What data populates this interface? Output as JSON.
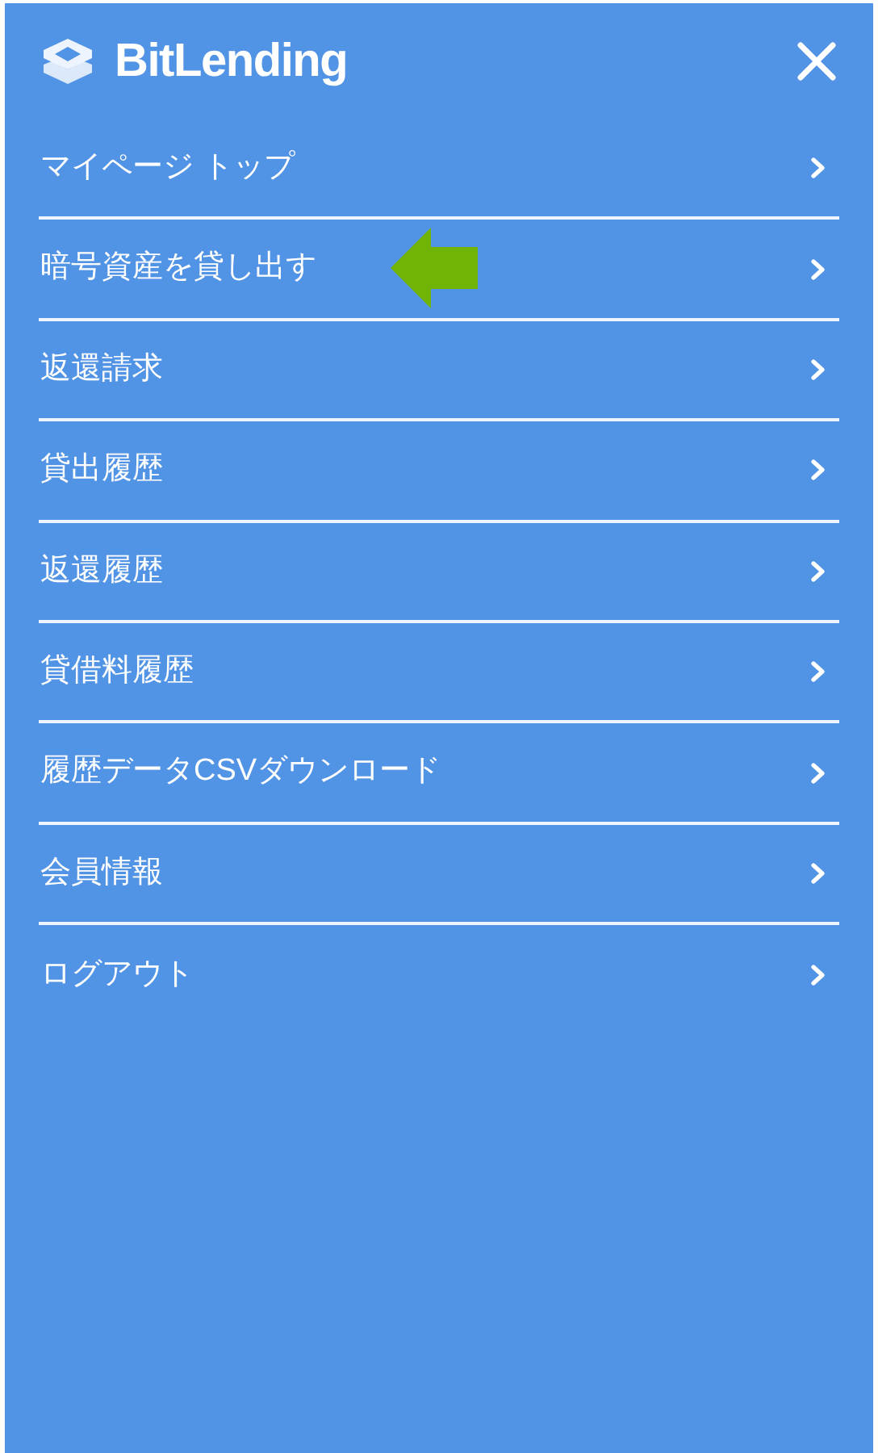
{
  "header": {
    "logo_text": "BitLending"
  },
  "menu": {
    "items": [
      {
        "label": "マイページ トップ",
        "pointed": false
      },
      {
        "label": "暗号資産を貸し出す",
        "pointed": true
      },
      {
        "label": "返還請求",
        "pointed": false
      },
      {
        "label": "貸出履歴",
        "pointed": false
      },
      {
        "label": "返還履歴",
        "pointed": false
      },
      {
        "label": "貸借料履歴",
        "pointed": false
      },
      {
        "label": "履歴データCSVダウンロード",
        "pointed": false
      },
      {
        "label": "会員情報",
        "pointed": false
      },
      {
        "label": "ログアウト",
        "pointed": false
      }
    ]
  }
}
